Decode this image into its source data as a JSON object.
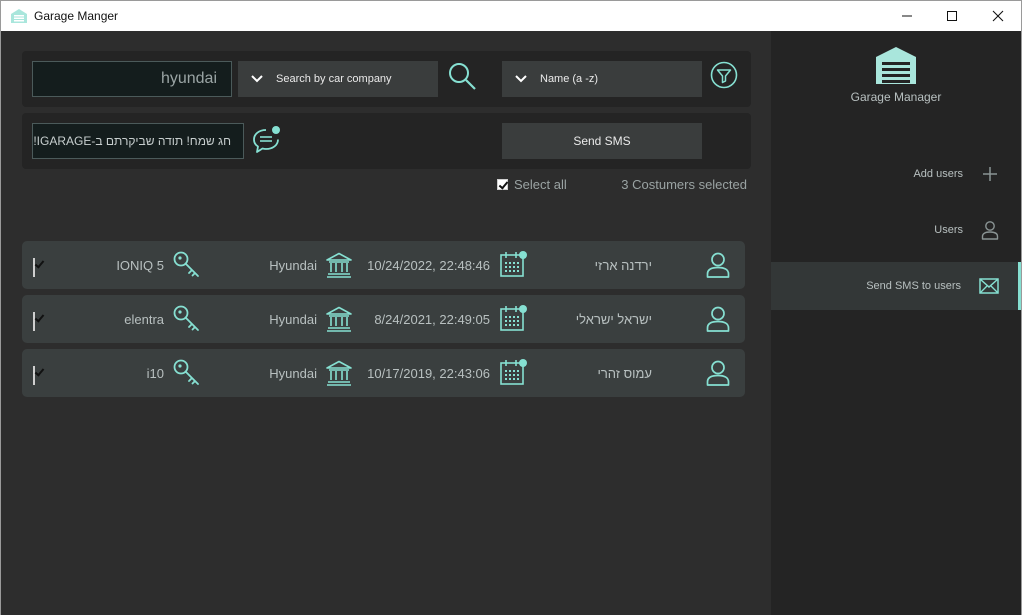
{
  "window": {
    "title": "Garage Manger",
    "controls": {
      "minimize": "—",
      "maximize": "☐",
      "close": "✕"
    }
  },
  "toolbar": {
    "search_value": "hyundai",
    "search_by_label": "Search by car company",
    "sort_label": "Name (a -z)",
    "sms_message": "חג שמח! תודה שביקרתם ב-IGARAGE!",
    "send_sms_label": "Send SMS"
  },
  "selection": {
    "select_all_label": "Select all",
    "selected_count_text": "3 Costumers selected"
  },
  "customers": [
    {
      "name": "ירדנה ארזי",
      "date": "10/24/2022, 22:48:46",
      "company": "Hyundai",
      "model": "IONIQ 5",
      "checked": true
    },
    {
      "name": "ישראל ישראלי",
      "date": "8/24/2021, 22:49:05",
      "company": "Hyundai",
      "model": "elentra",
      "checked": true
    },
    {
      "name": "עמוס זהרי",
      "date": "10/17/2019, 22:43:06",
      "company": "Hyundai",
      "model": "i10",
      "checked": true
    }
  ],
  "sidebar": {
    "logo_text": "Garage Manager",
    "items": [
      {
        "label": "Add users",
        "icon": "plus-icon",
        "active": false
      },
      {
        "label": "Users",
        "icon": "user-icon",
        "active": false
      },
      {
        "label": "Send SMS to users",
        "icon": "envelope-icon",
        "active": true
      }
    ]
  },
  "colors": {
    "accent": "#86e0d2",
    "background": "#2d2d2d",
    "sidebar_background": "#242424",
    "row_background": "#3a3f3f"
  }
}
